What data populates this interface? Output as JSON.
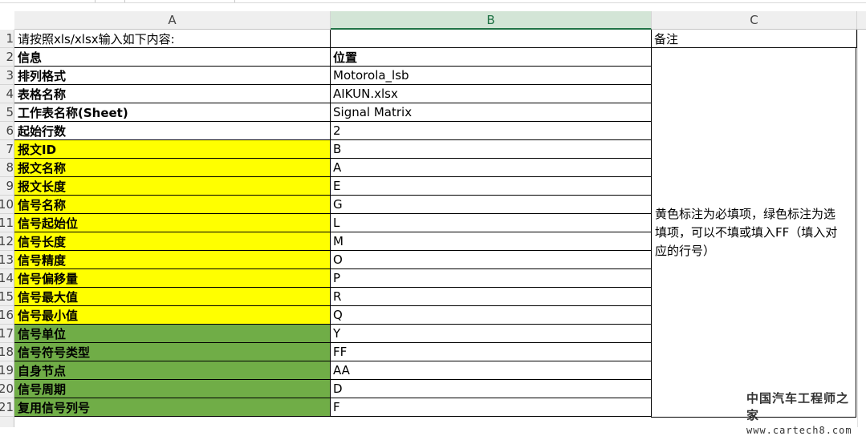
{
  "columns": [
    {
      "label": "A"
    },
    {
      "label": "B"
    },
    {
      "label": "C"
    }
  ],
  "rows": [
    {
      "num": "1",
      "a": "请按照xls/xlsx输入如下内容:",
      "b": ""
    },
    {
      "num": "2",
      "a": "信息",
      "b": "位置"
    },
    {
      "num": "3",
      "a": "排列格式",
      "b": "Motorola_lsb"
    },
    {
      "num": "4",
      "a": "表格名称",
      "b": "AIKUN.xlsx"
    },
    {
      "num": "5",
      "a": "工作表名称(Sheet)",
      "b": "Signal Matrix"
    },
    {
      "num": "6",
      "a": "起始行数",
      "b": "2"
    },
    {
      "num": "7",
      "a": "报文ID",
      "b": "B"
    },
    {
      "num": "8",
      "a": "报文名称",
      "b": "A"
    },
    {
      "num": "9",
      "a": "报文长度",
      "b": "E"
    },
    {
      "num": "10",
      "a": "信号名称",
      "b": "G"
    },
    {
      "num": "11",
      "a": "信号起始位",
      "b": "L"
    },
    {
      "num": "12",
      "a": "信号长度",
      "b": "M"
    },
    {
      "num": "13",
      "a": "信号精度",
      "b": "O"
    },
    {
      "num": "14",
      "a": "信号偏移量",
      "b": "P"
    },
    {
      "num": "15",
      "a": "信号最大值",
      "b": "R"
    },
    {
      "num": "16",
      "a": "信号最小值",
      "b": "Q"
    },
    {
      "num": "17",
      "a": "信号单位",
      "b": "Y"
    },
    {
      "num": "18",
      "a": "信号符号类型",
      "b": "FF"
    },
    {
      "num": "19",
      "a": "自身节点",
      "b": "AA"
    },
    {
      "num": "20",
      "a": "信号周期",
      "b": "D"
    },
    {
      "num": "21",
      "a": "复用信号列号",
      "b": "F"
    }
  ],
  "notes": {
    "header": "备注",
    "text": "黄色标注为必填项，绿色标注为选填项，可以不填或填入FF（填入对应的行号）"
  },
  "colors": {
    "required_fill": "#ffff00",
    "optional_fill": "#70ad47",
    "selected_header": "#217346"
  },
  "watermark": {
    "cn": "中国汽车工程师之家",
    "url": "www.cartech8.com"
  }
}
